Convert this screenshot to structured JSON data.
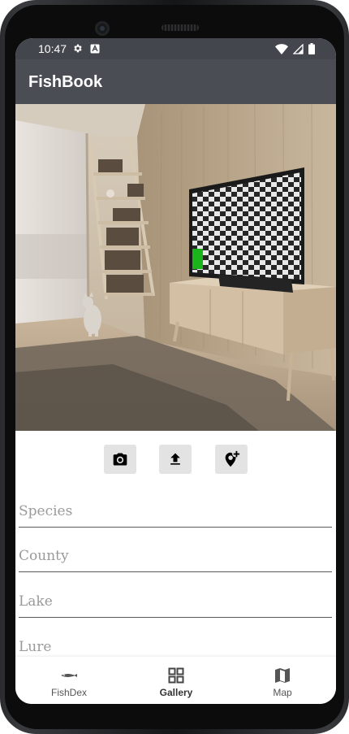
{
  "status_bar": {
    "time": "10:47"
  },
  "app_bar": {
    "title": "FishBook"
  },
  "photo": {
    "description_icon": "living-room-photo"
  },
  "actions": [
    {
      "name": "camera",
      "icon": "camera-icon"
    },
    {
      "name": "upload",
      "icon": "upload-icon"
    },
    {
      "name": "add-location",
      "icon": "add-location-icon"
    }
  ],
  "form": {
    "species_placeholder": "Species",
    "county_placeholder": "County",
    "lake_placeholder": "Lake",
    "lure_placeholder": "Lure"
  },
  "bottom_nav": {
    "items": [
      {
        "label": "FishDex",
        "icon": "fish-icon",
        "active": false
      },
      {
        "label": "Gallery",
        "icon": "grid-icon",
        "active": true
      },
      {
        "label": "Map",
        "icon": "map-icon",
        "active": false
      }
    ]
  },
  "colors": {
    "app_bar": "#4b4d55",
    "status_bar": "#44464d",
    "button_bg": "#e3e3e3"
  }
}
